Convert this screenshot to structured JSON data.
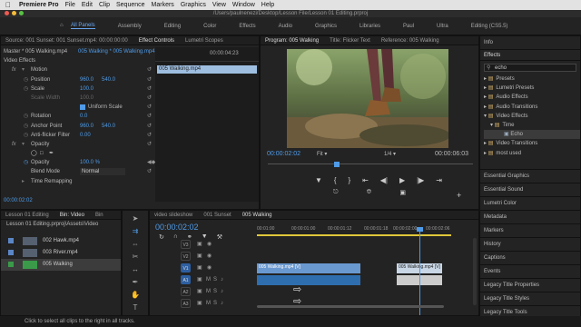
{
  "menubar": {
    "app": "Premiere Pro",
    "items": [
      "File",
      "Edit",
      "Clip",
      "Sequence",
      "Markers",
      "Graphics",
      "View",
      "Window",
      "Help"
    ]
  },
  "titlebar": {
    "path": "/Users/paulnenezi/Desktop/Lesson File/Lesson 01 Editing.prproj"
  },
  "workspaces": {
    "items": [
      "All Panels",
      "Assembly",
      "Editing",
      "Color",
      "Effects",
      "Audio",
      "Graphics",
      "Libraries",
      "Paul",
      "Ultra",
      "Editing (CS5.5)"
    ],
    "active": "All Panels"
  },
  "effect_controls": {
    "tabs": [
      "Source: 001 Sunset: 001 Sunset.mp4: 00:00:00:00",
      "Effect Controls",
      "Lumetri Scopes"
    ],
    "active_tab": "Effect Controls",
    "master": "Master * 005 Walking.mp4",
    "clip_path": "005 Walking * 005 Walking.mp4",
    "timecode_right": "00:00:04:23",
    "clip_label": "005 Walking.mp4",
    "video_effects_label": "Video Effects",
    "rows": [
      {
        "name": "Motion",
        "type": "effect"
      },
      {
        "name": "Position",
        "v1": "960.0",
        "v2": "540.0"
      },
      {
        "name": "Scale",
        "v1": "100.0"
      },
      {
        "name": "Scale Width",
        "v1": "100.0",
        "dim": true
      },
      {
        "name": "Uniform Scale",
        "type": "checkbox"
      },
      {
        "name": "Rotation",
        "v1": "0.0"
      },
      {
        "name": "Anchor Point",
        "v1": "960.0",
        "v2": "540.0"
      },
      {
        "name": "Anti-flicker Filter",
        "v1": "0.00"
      },
      {
        "name": "Opacity",
        "type": "effect"
      },
      {
        "name": "",
        "type": "masks"
      },
      {
        "name": "Opacity",
        "v1": "100.0 %"
      },
      {
        "name": "Blend Mode",
        "v1": "Normal",
        "type": "select"
      },
      {
        "name": "Time Remapping",
        "type": "effect"
      }
    ],
    "footer_timecode": "00:00:02:02"
  },
  "program": {
    "tabs": [
      "Program: 005 Walking",
      "Title: Flicker Text",
      "Reference: 005 Walking"
    ],
    "active_tab": "Program: 005 Walking",
    "timecode": "00:00:02:02",
    "fit": "Fit",
    "quality": "1/4",
    "duration": "00:00:06:03",
    "playhead_fraction": 0.33
  },
  "info_panel": {
    "info_label": "Info",
    "effects_label": "Effects",
    "search_value": "echo",
    "tree": [
      {
        "label": "Presets",
        "level": 0
      },
      {
        "label": "Lumetri Presets",
        "level": 0
      },
      {
        "label": "Audio Effects",
        "level": 0
      },
      {
        "label": "Audio Transitions",
        "level": 0
      },
      {
        "label": "Video Effects",
        "level": 0,
        "open": true
      },
      {
        "label": "Time",
        "level": 1,
        "open": true
      },
      {
        "label": "Echo",
        "level": 2,
        "selected": true
      },
      {
        "label": "Video Transitions",
        "level": 0
      },
      {
        "label": "most used",
        "level": 0
      }
    ],
    "sections": [
      "Essential Graphics",
      "Essential Sound",
      "Lumetri Color",
      "Metadata",
      "Markers",
      "History",
      "Captions",
      "Events",
      "Legacy Title Properties",
      "Legacy Title Styles",
      "Legacy Title Tools"
    ]
  },
  "project": {
    "tabs": [
      "Lesson 01 Editing",
      "Bin: Video",
      "Bin"
    ],
    "active_tab": "Bin: Video",
    "path": "Lesson 01 Editing.prproj\\Assets\\Video",
    "items": [
      {
        "name": "002 Hawk.mp4",
        "color": "#5b86c6"
      },
      {
        "name": "003 River.mp4",
        "color": "#5b86c6"
      },
      {
        "name": "005 Walking",
        "color": "#3a9a4a",
        "selected": true
      }
    ]
  },
  "tools": [
    "selection-tool",
    "track-select-tool",
    "ripple-edit-tool",
    "razor-tool",
    "slip-tool",
    "pen-tool",
    "hand-tool",
    "type-tool"
  ],
  "timeline": {
    "tabs": [
      "video slideshow",
      "001 Sunset",
      "005 Walking"
    ],
    "active_tab": "005 Walking",
    "timecode": "00:00:02:02",
    "ruler": [
      "00:01:00",
      "00:00:01:00",
      "00:00:01:12",
      "00:00:01:18",
      "00:00:02:00",
      "00:00:02:06"
    ],
    "tracks": [
      {
        "id": "V3",
        "type": "video"
      },
      {
        "id": "V2",
        "type": "video"
      },
      {
        "id": "V1",
        "type": "video",
        "on": true,
        "clip": "005 Walking.mp4 [V]",
        "clip2": "005 Walking.mp4 [V]"
      },
      {
        "id": "A1",
        "type": "audio",
        "on": true
      },
      {
        "id": "A2",
        "type": "audio"
      },
      {
        "id": "A3",
        "type": "audio"
      }
    ]
  },
  "status": {
    "text": "Click to select all clips to the right in all tracks."
  }
}
